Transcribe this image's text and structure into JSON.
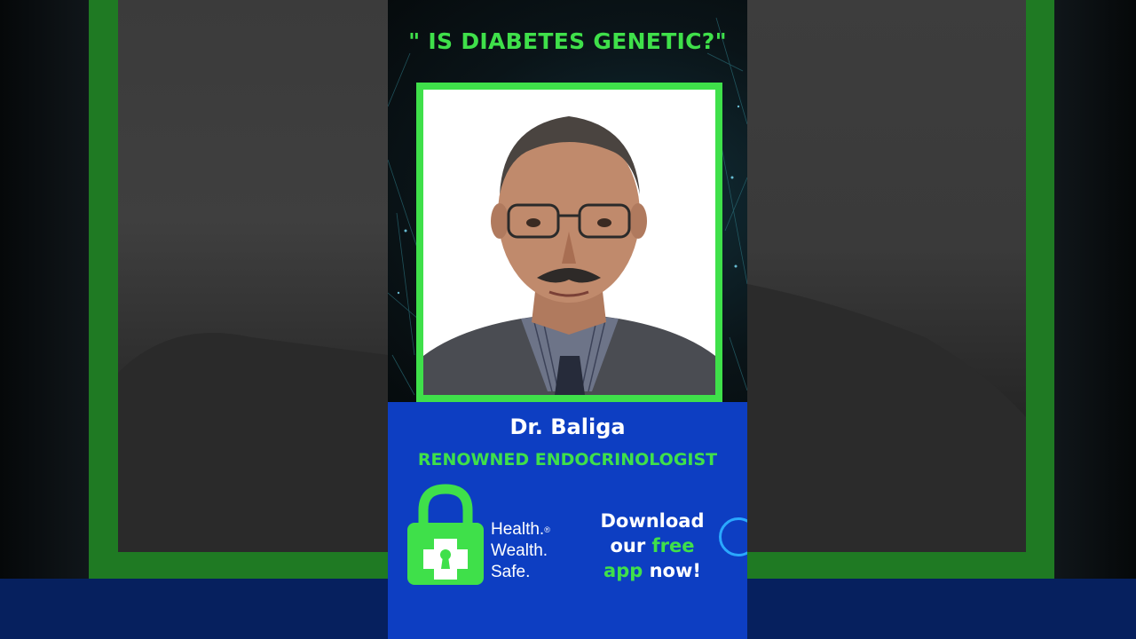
{
  "headline": "\" IS DIABETES GENETIC?\"",
  "presenter": {
    "name": "Dr. Baliga",
    "title": "RENOWNED ENDOCRINOLOGIST"
  },
  "logo": {
    "line1": "Health.",
    "registered": "®",
    "line2": "Wealth.",
    "line3": "Safe.",
    "icon": "padlock-cross-icon"
  },
  "cta": {
    "line1": "Download",
    "line2_prefix": "our ",
    "line2_highlight": "free",
    "line3_highlight": "app",
    "line3_suffix": " now!"
  },
  "colors": {
    "accent_green": "#3fe04a",
    "brand_blue": "#0d3ec2",
    "frame_green": "#1f7a23"
  }
}
